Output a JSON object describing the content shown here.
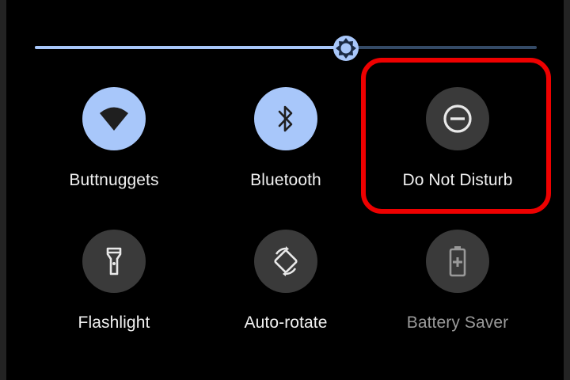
{
  "brightness": {
    "level": 0.62,
    "track_color": "#344a66",
    "fill_color": "#a8c7fa",
    "icon": "brightness-sun-icon"
  },
  "tiles": [
    {
      "id": "wifi",
      "label": "Buttnuggets",
      "icon": "wifi-icon",
      "state": "on"
    },
    {
      "id": "bluetooth",
      "label": "Bluetooth",
      "icon": "bluetooth-icon",
      "state": "on"
    },
    {
      "id": "do-not-disturb",
      "label": "Do Not Disturb",
      "icon": "do-not-disturb-icon",
      "state": "off"
    },
    {
      "id": "flashlight",
      "label": "Flashlight",
      "icon": "flashlight-icon",
      "state": "off"
    },
    {
      "id": "auto-rotate",
      "label": "Auto-rotate",
      "icon": "auto-rotate-icon",
      "state": "off"
    },
    {
      "id": "battery-saver",
      "label": "Battery Saver",
      "icon": "battery-saver-icon",
      "state": "unavailable"
    }
  ],
  "colors": {
    "tile_on": "#a8c7fa",
    "tile_off": "#3a3a3a",
    "icon_on": "#1f1f1f",
    "icon_off": "#e8e8e8",
    "highlight": "#ee0000"
  }
}
